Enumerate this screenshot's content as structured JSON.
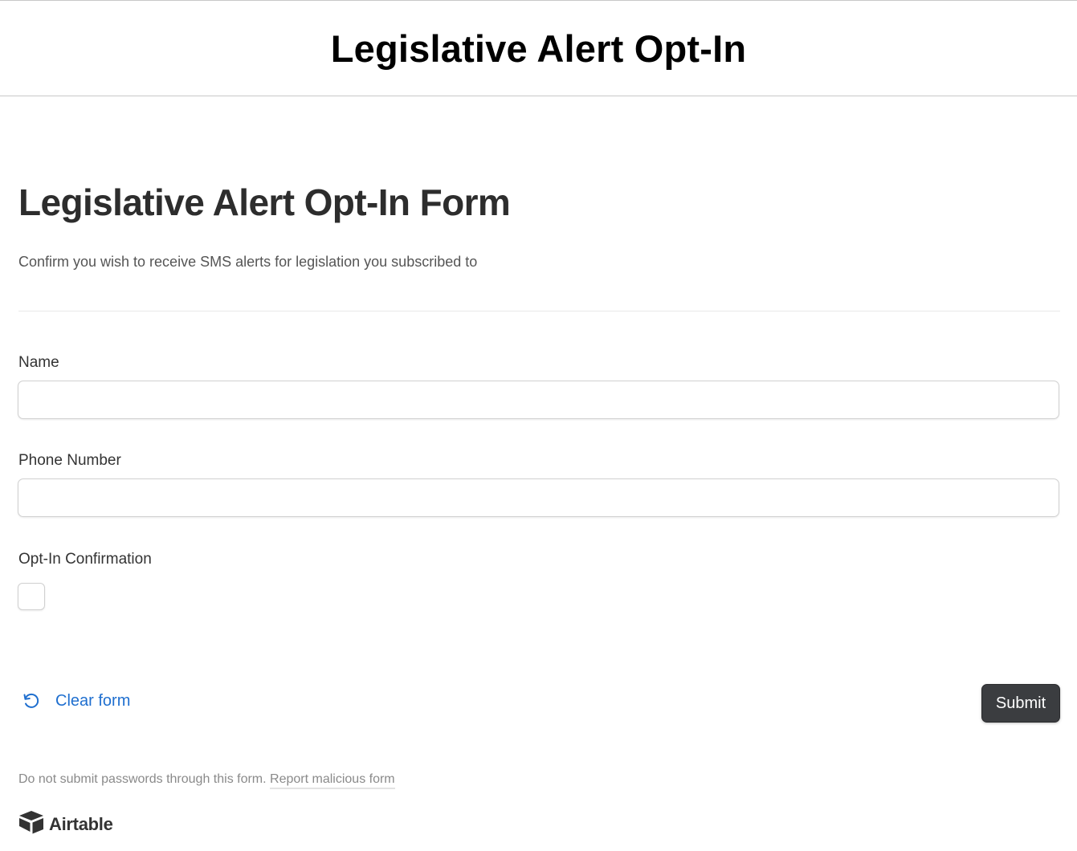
{
  "header": {
    "title": "Legislative Alert Opt-In"
  },
  "form": {
    "title": "Legislative Alert Opt-In Form",
    "description": "Confirm you wish to receive SMS alerts for legislation you subscribed to",
    "fields": [
      {
        "label": "Name",
        "value": "",
        "placeholder": ""
      },
      {
        "label": "Phone Number",
        "value": "",
        "placeholder": ""
      },
      {
        "label": "Opt-In Confirmation",
        "checked": false
      }
    ],
    "clear_label": "Clear form",
    "clear_icon": "undo-icon",
    "submit_label": "Submit"
  },
  "footer": {
    "note": "Do not submit passwords through this form.",
    "report_label": "Report malicious form",
    "brand_name": "Airtable",
    "brand_icon": "airtable-logo-icon"
  },
  "colors": {
    "link": "#1f6fcf",
    "submit_bg": "#3b3d40",
    "text": "#333333",
    "muted": "#8a8a8a"
  }
}
